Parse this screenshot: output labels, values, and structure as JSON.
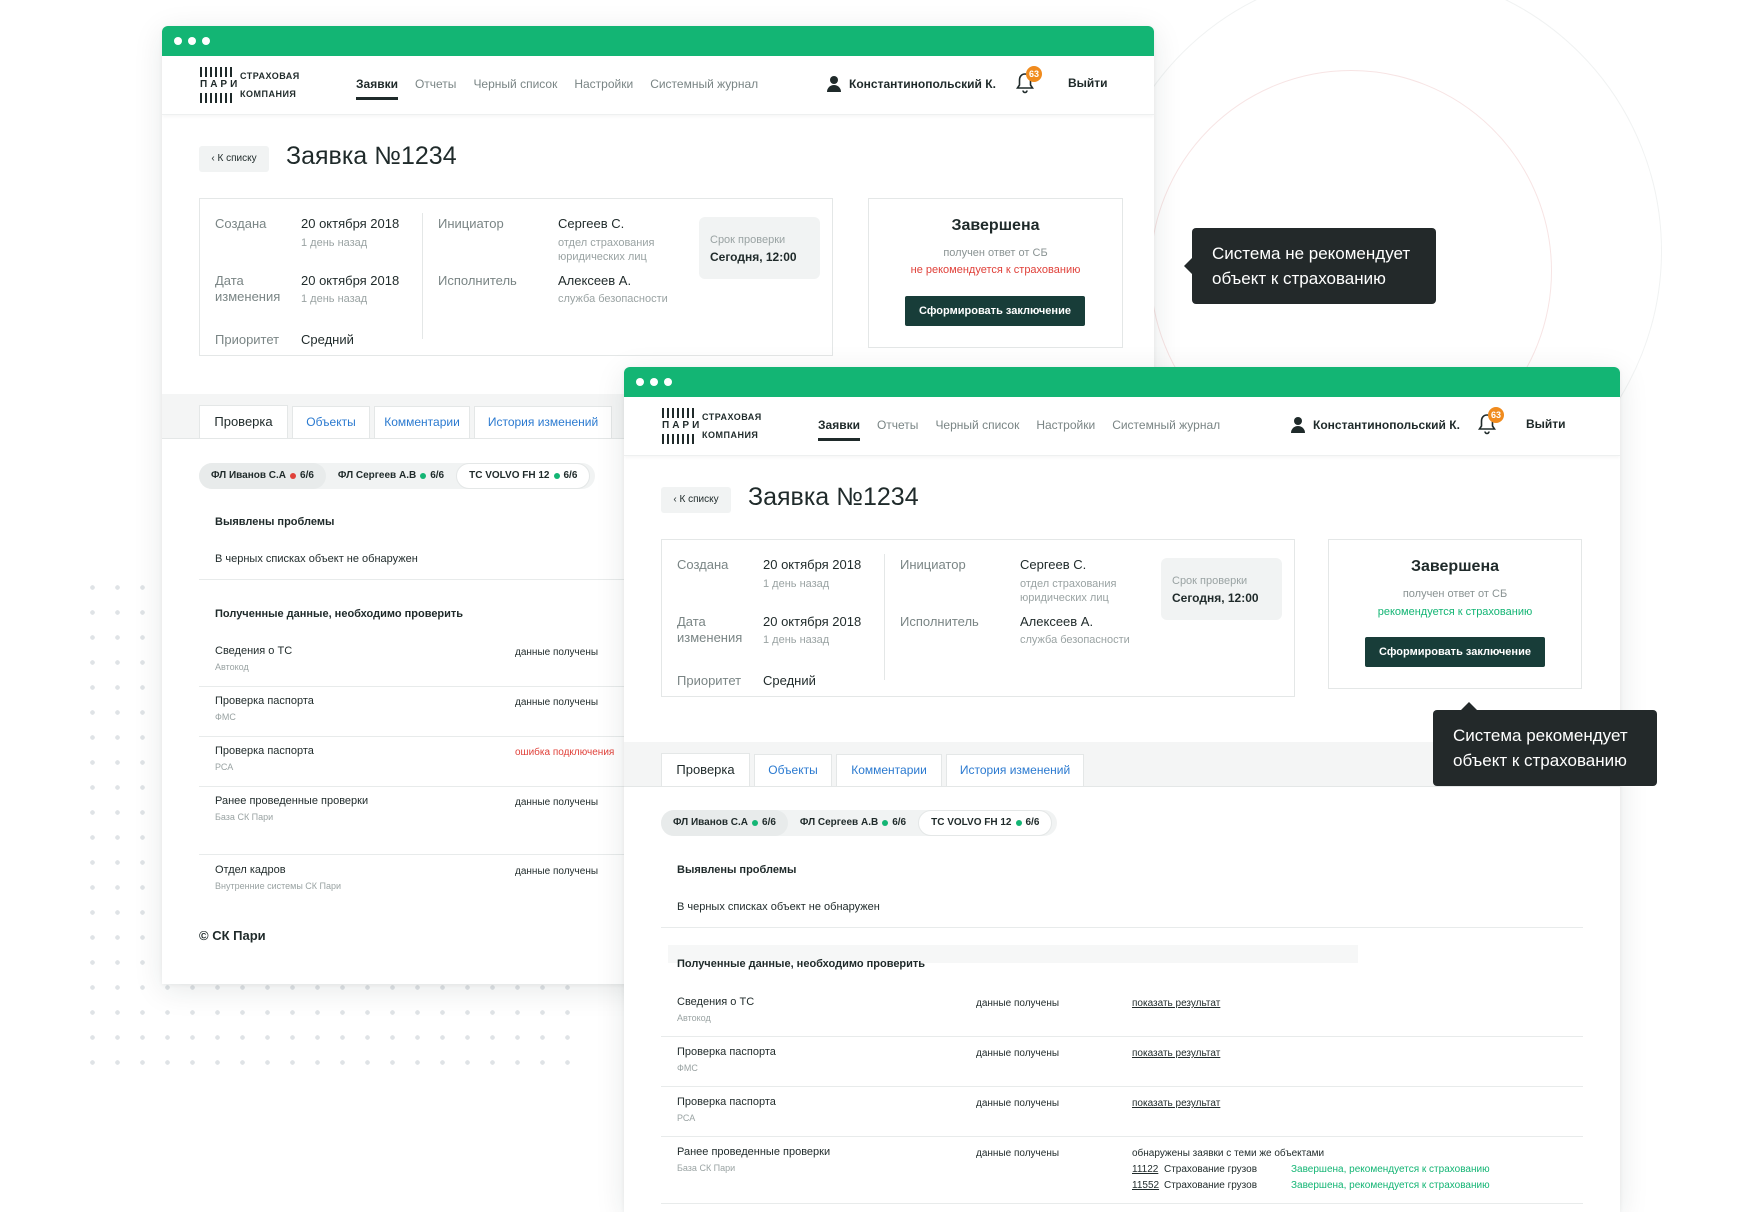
{
  "app": {
    "logo": {
      "mark": "ПАРИ",
      "line1": "СТРАХОВАЯ",
      "line2": "КОМПАНИЯ"
    },
    "menu": [
      "Заявки",
      "Отчеты",
      "Черный список",
      "Настройки",
      "Системный журнал"
    ],
    "user_name": "Константинопольский К.",
    "notifications": "63",
    "logout": "Выйти",
    "back": "‹ К списку",
    "title": "Заявка №1234",
    "created_label": "Создана",
    "created_date": "20 октября 2018",
    "created_ago": "1 день назад",
    "changed_label": "Дата изменения",
    "changed_date": "20 октября 2018",
    "changed_ago": "1 день назад",
    "priority_label": "Приоритет",
    "priority": "Средний",
    "initiator_label": "Инициатор",
    "initiator": "Сергеев С.",
    "initiator_dept": "отдел страхования юридических лиц",
    "executor_label": "Исполнитель",
    "executor": "Алексеев А.",
    "executor_dept": "служба безопасности",
    "deadline_label": "Срок проверки",
    "deadline": "Сегодня, 12:00",
    "status_title": "Завершена",
    "status_sub": "получен ответ от СБ",
    "status_button": "Сформировать заключение",
    "tabs": [
      "Проверка",
      "Объекты",
      "Комментарии",
      "История изменений"
    ],
    "chips": [
      {
        "label": "ФЛ Иванов С.А",
        "count": "6/6"
      },
      {
        "label": "ФЛ Сергеев А.В",
        "count": "6/6"
      },
      {
        "label": "ТС VOLVO FH 12",
        "count": "6/6"
      }
    ],
    "problems_heading": "Выявлены проблемы",
    "problems_text": "В черных списках объект не обнаружен",
    "data_heading": "Полученные данные, необходимо проверить"
  },
  "window1": {
    "status_verdict": "не рекомендуется к страхованию",
    "chip_dot_colors": [
      "#e0413a",
      "#13b574",
      "#13b574"
    ],
    "rows": [
      {
        "title": "Сведения о ТС",
        "source": "Автокод",
        "status": "данные получены",
        "error": false
      },
      {
        "title": "Проверка паспорта",
        "source": "ФМС",
        "status": "данные получены",
        "error": false
      },
      {
        "title": "Проверка паспорта",
        "source": "РСА",
        "status": "ошибка подключения",
        "error": true
      },
      {
        "title": "Ранее проведенные проверки",
        "source": "База СК Пари",
        "status": "данные получены",
        "error": false
      },
      {
        "title": "Отдел кадров",
        "source": "Внутренние системы СК Пари",
        "status": "данные получены",
        "error": false
      }
    ],
    "footer": "© СК Пари",
    "tooltip": "Система не рекомендует объект к страхованию"
  },
  "window2": {
    "status_verdict": "рекомендуется к страхованию",
    "chip_dot_colors": [
      "#13b574",
      "#13b574",
      "#13b574"
    ],
    "rows": [
      {
        "title": "Сведения о ТС",
        "source": "Автокод",
        "status": "данные получены",
        "link": "показать результат"
      },
      {
        "title": "Проверка паспорта",
        "source": "ФМС",
        "status": "данные получены",
        "link": "показать результат"
      },
      {
        "title": "Проверка паспорта",
        "source": "РСА",
        "status": "данные получены",
        "link": "показать результат"
      },
      {
        "title": "Ранее проведенные проверки",
        "source": "База СК Пари",
        "status": "данные получены",
        "link": ""
      }
    ],
    "related_heading": "обнаружены заявки с теми же объектами",
    "related": [
      {
        "number": "11122",
        "name": "Страхование грузов",
        "status": "Завершена, рекомендуется к страхованию"
      },
      {
        "number": "11552",
        "name": "Страхование грузов",
        "status": "Завершена, рекомендуется к страхованию"
      }
    ],
    "tooltip": "Система рекомендует объект к страхованию"
  },
  "colors": {
    "brand_green": "#13b574",
    "dark_button": "#183d39",
    "error_red": "#e0413a",
    "badge_orange": "#f08b1e"
  }
}
